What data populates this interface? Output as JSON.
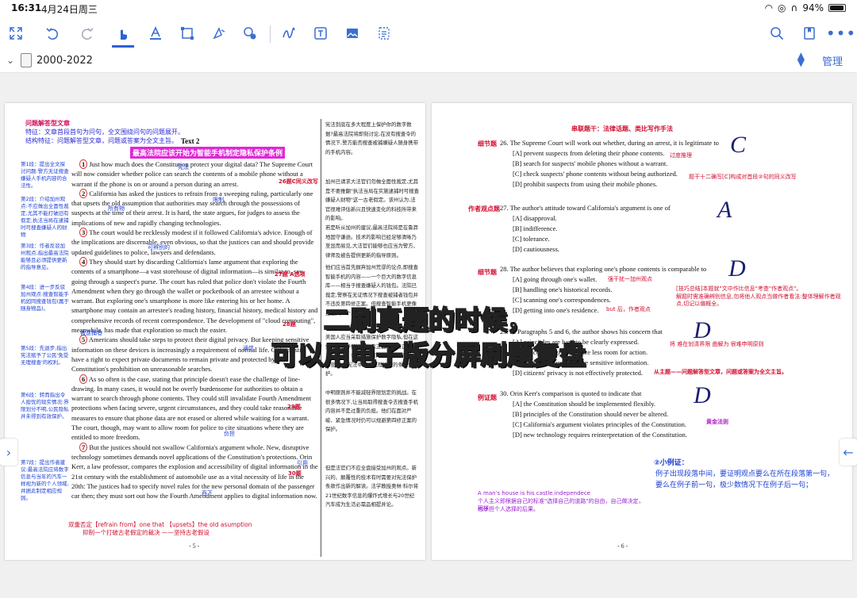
{
  "status_bar": {
    "time": "16:31",
    "date": "4月24日周三",
    "battery": "94%",
    "battery_level": 0.94
  },
  "toolbar": {
    "items": [
      {
        "name": "collapse-icon",
        "glyph": "⤡"
      },
      {
        "name": "undo-icon",
        "glyph": "↺"
      },
      {
        "name": "redo-icon",
        "glyph": "↻"
      },
      {
        "name": "hand-tool-icon",
        "glyph": "☝"
      },
      {
        "name": "text-highlight-icon",
        "glyph": "A"
      },
      {
        "name": "rectangle-select-icon",
        "glyph": "⬚"
      },
      {
        "name": "lasso-icon",
        "glyph": "✎"
      },
      {
        "name": "shape-settings-icon",
        "glyph": "⚙"
      },
      {
        "name": "pen-icon",
        "glyph": "∿"
      },
      {
        "name": "text-box-icon",
        "glyph": "T"
      },
      {
        "name": "image-icon",
        "glyph": "▣"
      },
      {
        "name": "ocr-scan-icon",
        "glyph": "⌗"
      }
    ],
    "right_items": [
      {
        "name": "search-icon",
        "glyph": "⌕"
      },
      {
        "name": "bookmark-icon",
        "glyph": "⎗"
      },
      {
        "name": "more-icon",
        "glyph": "⋯"
      }
    ]
  },
  "tabbar": {
    "doc_title": "2000-2022",
    "manage_label": "管理"
  },
  "page5": {
    "header_line1": "问题解答型文章",
    "header_line2": "特征：文章首段首句为问句，全文围绕问句的问题展开。",
    "header_line3": "结构特征：问题解答型文章，问题或答案为全文主旨。",
    "text_label": "Text 2",
    "banner": "最高法院应该开始为智能手机制定隐私保护条例",
    "paragraphs": [
      "Just how much does the Constitution protect your digital data? The Supreme Court will now consider whether police can search the contents of a mobile phone without a warrant if the phone is on or around a person during an arrest.",
      "California has asked the justices to refrain from a sweeping ruling, particularly one that upsets the old assumption that authorities may search through the possessions of suspects at the time of their arrest. It is hard, the state argues, for judges to assess the implications of new and rapidly changing technologies.",
      "The court would be recklessly modest if it followed California's advice. Enough of the implications are discernable, even obvious, so that the justices can and should provide updated guidelines to police, lawyers and defendants.",
      "They should start by discarding California's lame argument that exploring the contents of a smartphone—a vast storehouse of digital information—is similar to, say, going through a suspect's purse. The court has ruled that police don't violate the Fourth Amendment when they go through the wallet or pocketbook of an arrestee without a warrant. But exploring one's smartphone is more like entering his or her home. A smartphone may contain an arrestee's reading history, financial history, medical history and comprehensive records of recent correspondence. The development of \"cloud computing\", meanwhile, has made that exploration so much the easier.",
      "Americans should take steps to protect their digital privacy. But keeping sensitive information on these devices is increasingly a requirement of normal life. Citizens still have a right to expect private documents to remain private and protected by the Constitution's prohibition on unreasonable searches.",
      "As so often is the case, stating that principle doesn't ease the challenge of line-drawing. In many cases, it would not be overly burdensome for authorities to obtain a warrant to search through phone contents. They could still invalidate Fourth Amendment protections when facing severe, urgent circumstances, and they could take reasonable measures to ensure that phone data are not erased or altered while waiting for a warrant. The court, though, may want to allow room for police to cite situations where they are entitled to more freedom.",
      "But the justices should not swallow California's argument whole. New, disruptive technology sometimes demands novel applications of the Constitution's protections. Orin Kerr, a law professor, compares the explosion and accessibility of digital information in the 21st century with the establishment of automobile use as a vital necessity of life in the 20th: The justices had to specify novel rules for the new personal domain of the passenger car then; they must sort out how the Fourth Amendment applies to digital information now."
    ],
    "para_numbers": [
      "1",
      "2",
      "3",
      "4",
      "5",
      "6",
      "7"
    ],
    "footer_note1": "双重否定【refrain from】one that 【upsets】the old asumption",
    "footer_note2": "抑制一个打破古老假定的裁决 ——坚持古老假设",
    "page_number": "- 5 -",
    "side_notes": [
      "第1段：提出全文探讨问题:警方无证搜查嫌疑人手机内容的合法性。",
      "第2段：介绍加州观点:不应做出全面性裁定,尤其不能打破旧有假定,执法当局在逮捕时可搜查嫌疑人的财物",
      "第3段：作者反驳加州观点,指出最高法院能够且必须提供更新的指导意见。",
      "第4段：进一步反驳加州观点:搜查智能手机如同搜查钱包(属于随身物品)。",
      "第5段：先退步,指出宪法赋予了公民'免受无理搜查'的权利。",
      "第6段：转而指出令人担忧的现实情况:界限划分不明,公民隐私并未得到有效保护。",
      "第7段：提出作者建议:最高法院应将数字信息与当年的汽车一样视为新的个人领域,并据此制定相应规则。"
    ],
    "annotations_blue": [
      "宪法",
      "最高法院",
      "搜查",
      "逮捕",
      "限制",
      "裁定",
      "所有物",
      "嫌疑人",
      "启示",
      "鲁莽的",
      "可辨别的",
      "被逮捕者",
      "通信",
      "钱包",
      "存储",
      "抑制",
      "禁止",
      "一般地",
      "公然违反",
      "负担",
      "紧急的",
      "引用",
      "吞下",
      "颠覆性的",
      "法学教授",
      "领域"
    ],
    "annotations_red": [
      "26题C同义改写",
      "27题 A选项",
      "28题",
      "29题",
      "30题"
    ],
    "chinese_column": [
      "宪法到底在多大程度上保护你的数字数据?最高法院将即刻讨论,在没有搜查令的情况下,警方能否搜查被捕嫌疑人随身携带的手机内容。",
      "加州已请求大法官们勿做全面性裁定,尤其是不要推翻\"执法当局在实施逮捕时可搜查嫌疑人财物\"这一古老假定。该州认为,法官很难评估新兴且快速变化的科技所带来的影响。",
      "若是听从加州的建议,最高法院将是在鲁莽地固守谦逊。技术的影响已经足够清晰乃至显而易见,大法官们能够也应当为警方、律师及被告提供更新的指导原则。",
      "他们应当首先摒弃加州荒谬的论点,即搜查智能手机的内容——一个巨大的数字信息库——相当于搜查嫌疑人的钱包。法院已裁定,警察在无证情况下搜查被捕者钱包并不违反第四修正案。但搜查智能手机更像是进入一个人的家。",
      "美国人应当采取措施保护数字隐私,但在这些设备上存储敏感信息正日益成为正常生活的要求。公民仍有权期望私人文件保持私密,并受宪法中禁止无理搜查的条款保护。",
      "中明原则并不能减轻界限划定的挑战。在很多情况下,让当局取得搜查令去搜查手机内容并不是过重的负担。他们在面对严峻、紧急情况时仍可以规避第四修正案的保护。",
      "但是法官们不应全盘接受加州的观点。新兴的、颠覆性的技术有时需要对宪法保护条款作出新的解读。法学教授奥林·科尔将21世纪数字信息的爆炸式增长与20世纪汽车成为生活必需品相提并论。"
    ]
  },
  "page6": {
    "header": "串联题干：法律话题、类比写作手法",
    "questions": [
      {
        "label": "细节题",
        "stem": "26. The Supreme Court will work out whether, during an arrest, it is legitimate to",
        "options": [
          "[A] prevent suspects from deleting their phone contents.",
          "[B] search for suspects' mobile phones without a warrant.",
          "[C] check suspects' phone contents without being authorized.",
          "[D] prohibit suspects from using their mobile phones."
        ],
        "answer": "C"
      },
      {
        "label": "作者观点题",
        "stem": "27. The author's attitude toward California's argument is one of",
        "options": [
          "[A] disapproval.",
          "[B] indifference.",
          "[C] tolerance.",
          "[D] cautiousness."
        ],
        "answer": "A"
      },
      {
        "label": "细节题",
        "stem": "28. The author believes that exploring one's phone contents is comparable to",
        "options": [
          "[A] going through one's wallet.",
          "[B] handling one's historical records.",
          "[C] scanning one's correspondences.",
          "[D] getting into one's residence."
        ],
        "answer": "D"
      },
      {
        "label": "",
        "stem": "29. In Paragraphs 5 and 6, the author shows his concern that",
        "options": [
          "[A] principles are hard to be clearly expressed.",
          "[B] the court is giving police less room for action.",
          "[C] phones are used to store sensitive information.",
          "[D] citizens' privacy is not effectively protected."
        ],
        "answer": "D"
      },
      {
        "label": "例证题",
        "stem": "30. Orin Kerr's comparison is quoted to indicate that",
        "options": [
          "[A] the Constitution should be implemented flexibly.",
          "[B] principles of the Constitution should never be altered.",
          "[C] California's argument violates principles of the Constitution.",
          "[D] new technology requires reinterpretation of the Constitution."
        ],
        "answer": "D"
      }
    ],
    "notes": {
      "n26": "题干十二确写[C]构成对首段②句的同义改写",
      "n27": "过度推理",
      "n28a": "强干扰一加州观点",
      "n28b": "[技巧总结]本题就\"文中作比信息\"考查\"作者观点\"。",
      "n28c": "解题时需准确辨别信息,勿将他人观点当做作者看法:整体理解作者观点,切记以偏概全。",
      "n28d": "but 后，作者观点",
      "n29a": "将 难在划清界限 曲解为 很难申明原则",
      "n29b": "从主题——问题解答型文章，问题或答案为全文主旨。",
      "n30": "黄金法则",
      "example_title": "②小例证：",
      "example_line1": "例子出现段落中间，要证明观点要么在所在段落第一句，",
      "example_line2": "要么在例子前一句，极少数情况下在例子后一句；",
      "proverb_en": "A man's house is his castle.independece",
      "proverb_cn1": "个人主义即根据自己的标准\"选择自己的道路\"的自由，自己做决定，同样",
      "proverb_cn2": "也承担个人选择的后果。"
    },
    "page_number": "- 6 -"
  },
  "overlay": {
    "line1": "二刷真题的时候，",
    "line2": "可以用电子版分屏刷题复盘"
  },
  "colors": {
    "accent": "#3b6fd1",
    "annotation_blue": "#1b3fd4",
    "annotation_red": "#d10f2f",
    "overlay_text": "#ffe84a",
    "magenta": "#e028d8"
  }
}
